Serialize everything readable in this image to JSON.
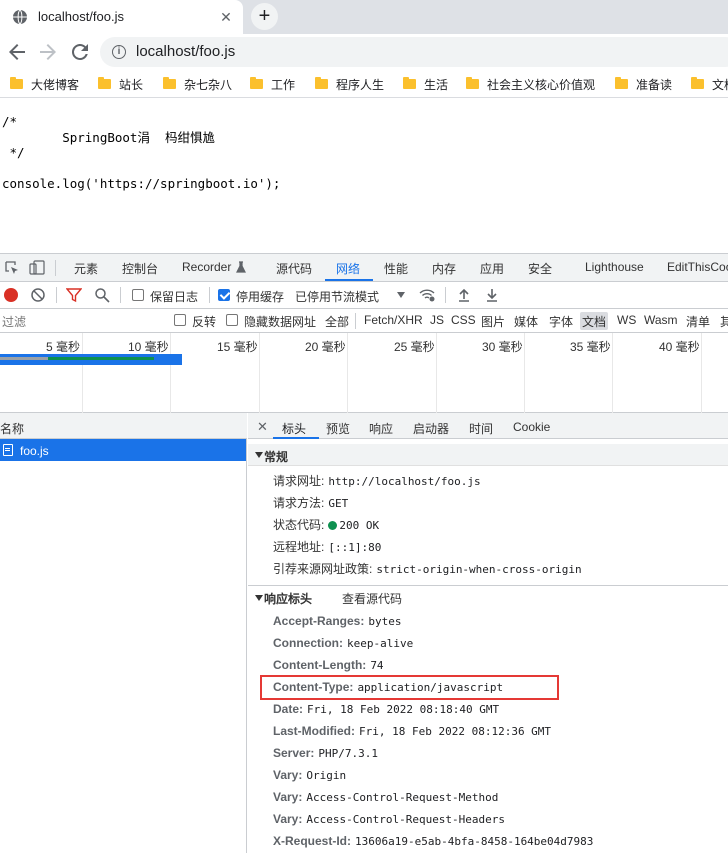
{
  "browser": {
    "tab_title": "localhost/foo.js",
    "tab_close": "✕",
    "new_tab": "+",
    "url": "localhost/foo.js"
  },
  "bookmarks": [
    "大佬博客",
    "站长",
    "杂七杂八",
    "工作",
    "程序人生",
    "生活",
    "社会主义核心价值观",
    "准备读",
    "文档"
  ],
  "page": {
    "source_lines": "/*\n        SpringBoot涓  杩绀惧尯\n */\n\nconsole.log('https://springboot.io');"
  },
  "devtools": {
    "tabs": [
      "元素",
      "控制台",
      "Recorder",
      "源代码",
      "网络",
      "性能",
      "内存",
      "应用",
      "安全",
      "Lighthouse",
      "EditThisCookie"
    ],
    "active_tab": "网络",
    "network_toolbar": {
      "preserve_log": "保留日志",
      "disable_cache": "停用缓存",
      "throttling": "已停用节流模式"
    },
    "filter_bar": {
      "filter_placeholder": "过滤",
      "invert": "反转",
      "hide_data_urls": "隐藏数据网址",
      "types": [
        "全部",
        "Fetch/XHR",
        "JS",
        "CSS",
        "图片",
        "媒体",
        "字体",
        "文档",
        "WS",
        "Wasm",
        "清单",
        "其他"
      ],
      "selected_type": "文档"
    },
    "overview": {
      "labels": [
        "5 毫秒",
        "10 毫秒",
        "15 毫秒",
        "20 毫秒",
        "25 毫秒",
        "30 毫秒",
        "35 毫秒",
        "40 毫秒"
      ]
    },
    "request_list": {
      "header": "名称",
      "items": [
        "foo.js"
      ]
    },
    "details": {
      "close": "✕",
      "tabs": [
        "标头",
        "预览",
        "响应",
        "启动器",
        "时间",
        "Cookie"
      ],
      "active_tab": "标头",
      "general": {
        "title": "常规",
        "rows": [
          {
            "key": "请求网址:",
            "value": "http://localhost/foo.js"
          },
          {
            "key": "请求方法:",
            "value": "GET"
          },
          {
            "key": "状态代码:",
            "value": "200 OK"
          },
          {
            "key": "远程地址:",
            "value": "[::1]:80"
          },
          {
            "key": "引荐来源网址政策:",
            "value": "strict-origin-when-cross-origin"
          }
        ]
      },
      "response_headers": {
        "title": "响应标头",
        "view_source": "查看源代码",
        "rows": [
          {
            "key": "Accept-Ranges:",
            "value": "bytes"
          },
          {
            "key": "Connection:",
            "value": "keep-alive"
          },
          {
            "key": "Content-Length:",
            "value": "74"
          },
          {
            "key": "Content-Type:",
            "value": "application/javascript"
          },
          {
            "key": "Date:",
            "value": "Fri, 18 Feb 2022 08:18:40 GMT"
          },
          {
            "key": "Last-Modified:",
            "value": "Fri, 18 Feb 2022 08:12:36 GMT"
          },
          {
            "key": "Server:",
            "value": "PHP/7.3.1"
          },
          {
            "key": "Vary:",
            "value": "Origin"
          },
          {
            "key": "Vary:",
            "value": "Access-Control-Request-Method"
          },
          {
            "key": "Vary:",
            "value": "Access-Control-Request-Headers"
          },
          {
            "key": "X-Request-Id:",
            "value": "13606a19-e5ab-4bfa-8458-164be04d7983"
          }
        ]
      }
    }
  },
  "colors": {
    "accent": "#1a73e8",
    "status_ok": "#0d904f",
    "highlight": "#e53935",
    "record": "#d93025"
  }
}
